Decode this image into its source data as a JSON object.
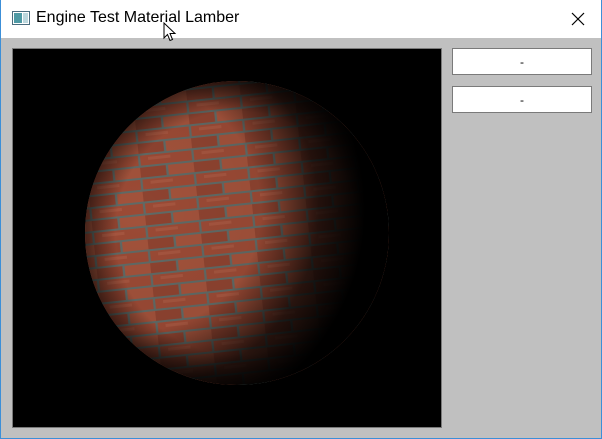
{
  "window": {
    "title": "Engine Test Material Lamber",
    "icon": "app-window-icon",
    "close_icon": "close-icon"
  },
  "viewport": {
    "content": "brick-textured-sphere-lambert-lit",
    "background_color": "#000000",
    "brick_color": "#9b4a35",
    "mortar_color": "#5f6a66"
  },
  "sidebar": {
    "buttons": [
      {
        "label": "-"
      },
      {
        "label": "-"
      }
    ]
  },
  "colors": {
    "client_background": "#c0c0c0",
    "title_background": "#ffffff",
    "window_border": "#3c8fd8"
  }
}
